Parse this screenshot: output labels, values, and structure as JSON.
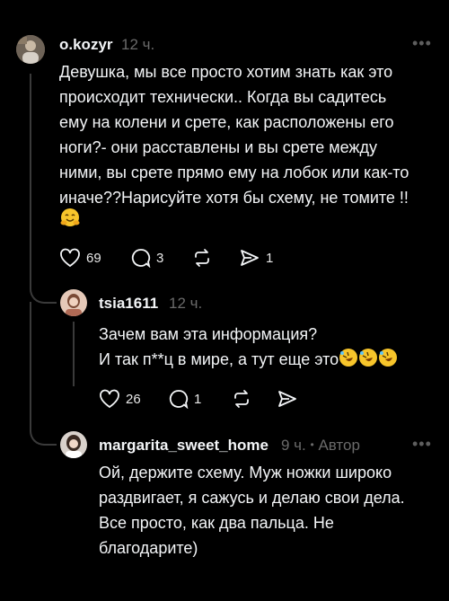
{
  "comments": [
    {
      "username": "o.kozyr",
      "time": "12 ч.",
      "text_lines": [
        "Девушка, мы все просто хотим знать как это",
        "происходит технически.. Когда вы садитесь",
        "ему на колени и срете, как расположены его",
        "ноги?- они расставлены и вы срете между",
        "ними, вы срете прямо ему на лобок или как-то",
        "иначе??Нарисуйте хотя бы схему, не томите !!"
      ],
      "emoji": "hugging-face",
      "likes": "69",
      "replies": "3",
      "shares": "1"
    },
    {
      "username": "tsia1611",
      "time": "12 ч.",
      "text_lines": [
        "Зачем вам эта информация?",
        "И так п**ц в мире, а тут еще это"
      ],
      "emoji": "rolling-laughing x3",
      "likes": "26",
      "replies": "1"
    },
    {
      "username": "margarita_sweet_home",
      "time": "9 ч.",
      "separator": "•",
      "author_badge": "Автор",
      "text_lines": [
        "Ой, держите схему. Муж ножки широко",
        "раздвигает, я сажусь и делаю свои дела.",
        "Все просто, как два пальца. Не",
        "благодарите)"
      ]
    }
  ],
  "colors": {
    "background": "#000000",
    "text": "#f3f5f7",
    "muted": "#6a6a6a",
    "thread": "#3a3a3a",
    "emoji": "#f7c52b"
  },
  "icons": [
    "heart-icon",
    "comment-icon",
    "repost-icon",
    "send-icon",
    "more-icon"
  ]
}
